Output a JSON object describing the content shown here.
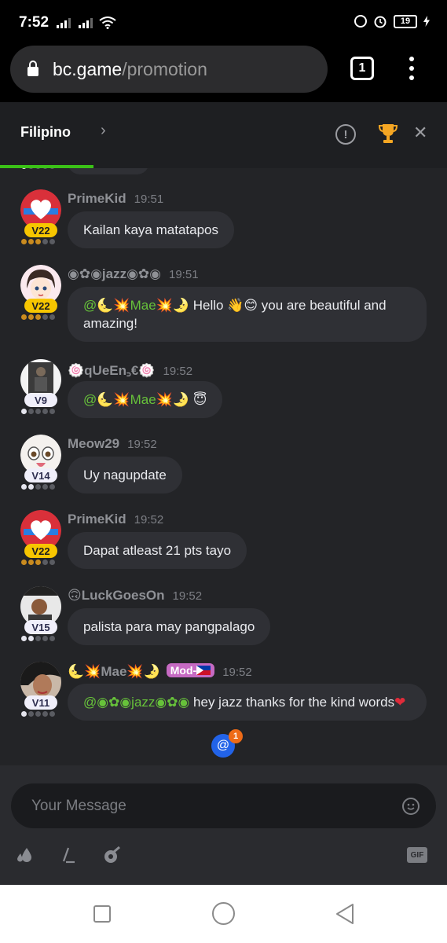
{
  "status_bar": {
    "time": "7:52",
    "battery": "19"
  },
  "browser": {
    "url_host": "bc.game",
    "url_path": "/promotion",
    "tab_count": "1"
  },
  "chat_header": {
    "language": "Filipino"
  },
  "messages": [
    {
      "user": "PrimeKid",
      "time": "19:51",
      "vip": "V22",
      "text": "Kailan kaya matatapos"
    },
    {
      "user": "◉✿◉jazz◉✿◉",
      "time": "19:51",
      "vip": "V22",
      "mention": "@🌜💥Mae💥🌛",
      "text": " Hello 👋😊 you are beautiful and amazing!"
    },
    {
      "user": "🍥qUeEn꜆€🍥",
      "time": "19:52",
      "vip": "V9",
      "mention": "@🌜💥Mae💥🌛",
      "text": " 😇"
    },
    {
      "user": "Meow29",
      "time": "19:52",
      "vip": "V14",
      "text": "Uy nagupdate"
    },
    {
      "user": "PrimeKid",
      "time": "19:52",
      "vip": "V22",
      "text": "Dapat atleast 21 pts tayo"
    },
    {
      "user": "🙃LuckGoesOn",
      "time": "19:52",
      "vip": "V15",
      "text": "palista para may pangpalago"
    },
    {
      "user": "🌜💥Mae💥🌛",
      "badge": "Mod-",
      "time": "19:52",
      "vip": "V11",
      "mention": "@◉✿◉jazz◉✿◉",
      "text": " hey jazz thanks for the kind words",
      "text_emoji": "❤"
    }
  ],
  "mentions_badge": {
    "symbol": "@",
    "count": "1"
  },
  "composer": {
    "placeholder": "Your Message",
    "gif_label": "GIF"
  },
  "colors": {
    "accent_green": "#3bc117",
    "chat_bg": "#232427",
    "bubble_bg": "#2f3035",
    "mention": "#67c23a",
    "vip_gold": "#f7c600",
    "mod_badge": "#c66ac3",
    "mention_button": "#2263e8"
  },
  "icons": [
    "lock-icon",
    "tabs-icon",
    "more-vert-icon",
    "chevron-right-icon",
    "info-icon",
    "trophy-icon",
    "close-icon",
    "emoji-icon",
    "rain-icon",
    "command-icon",
    "coin-icon",
    "gif-icon",
    "recents-icon",
    "home-icon",
    "back-icon"
  ]
}
